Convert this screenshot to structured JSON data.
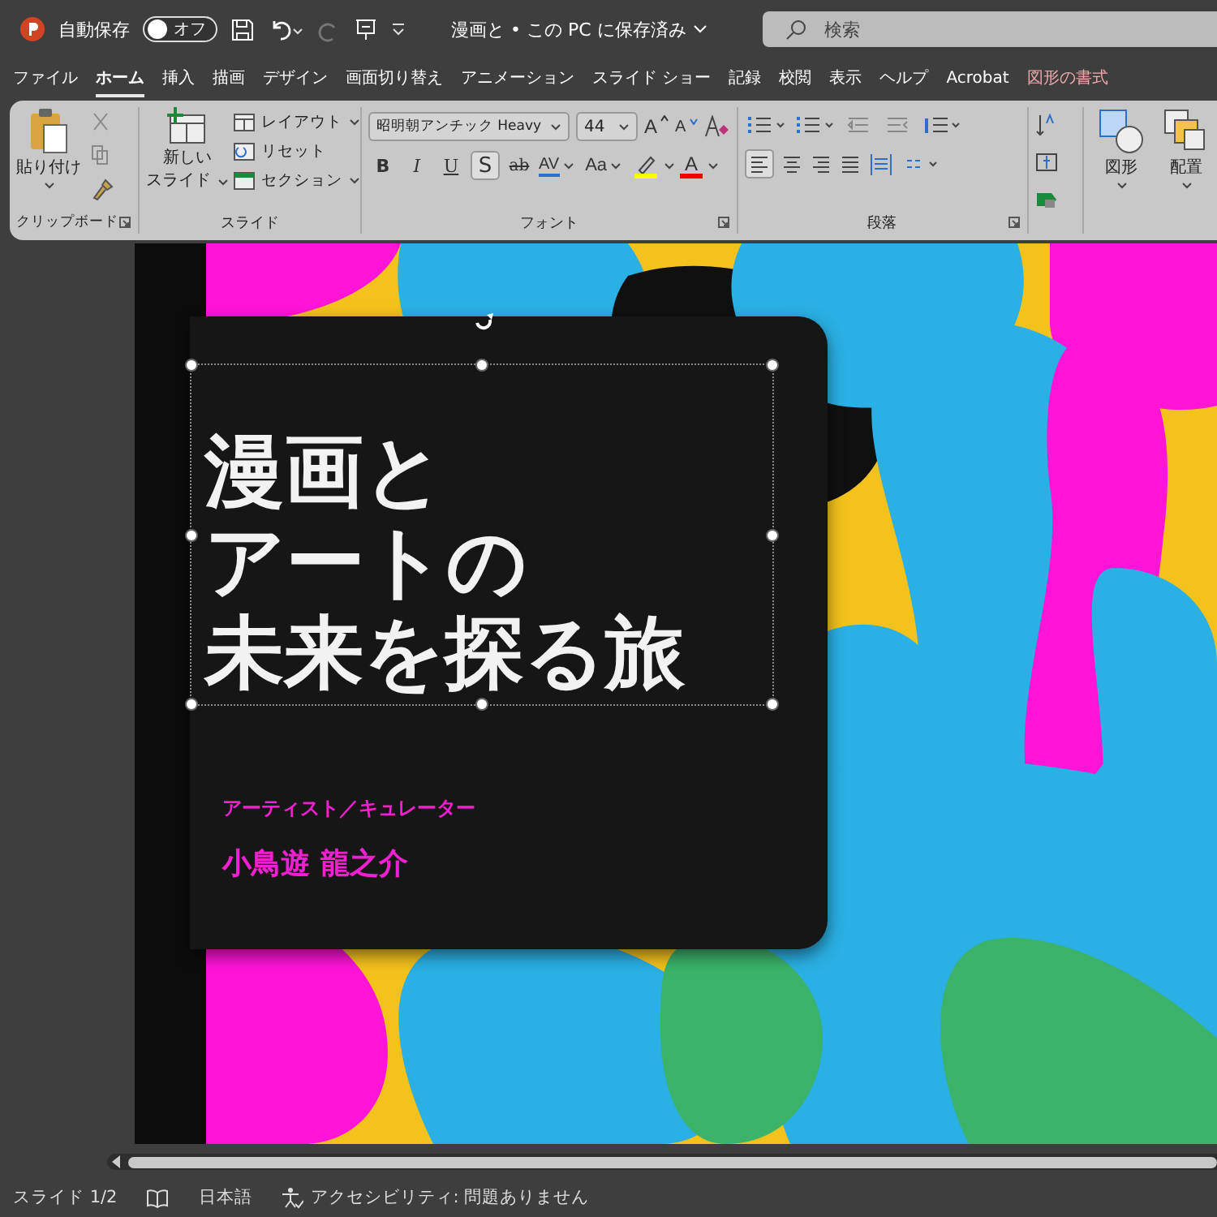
{
  "title_bar": {
    "autosave_label": "自動保存",
    "autosave_toggle": {
      "label": "オフ",
      "on": false
    },
    "document_title": "漫画と • この PC に保存済み",
    "search": {
      "placeholder": "検索"
    }
  },
  "tabs": [
    {
      "label": "ファイル",
      "selected": false,
      "kind": "normal"
    },
    {
      "label": "ホーム",
      "selected": true,
      "kind": "normal"
    },
    {
      "label": "挿入",
      "selected": false,
      "kind": "normal"
    },
    {
      "label": "描画",
      "selected": false,
      "kind": "normal"
    },
    {
      "label": "デザイン",
      "selected": false,
      "kind": "normal"
    },
    {
      "label": "画面切り替え",
      "selected": false,
      "kind": "normal"
    },
    {
      "label": "アニメーション",
      "selected": false,
      "kind": "normal"
    },
    {
      "label": "スライド ショー",
      "selected": false,
      "kind": "normal"
    },
    {
      "label": "記録",
      "selected": false,
      "kind": "normal"
    },
    {
      "label": "校閲",
      "selected": false,
      "kind": "normal"
    },
    {
      "label": "表示",
      "selected": false,
      "kind": "normal"
    },
    {
      "label": "ヘルプ",
      "selected": false,
      "kind": "normal"
    },
    {
      "label": "Acrobat",
      "selected": false,
      "kind": "normal"
    },
    {
      "label": "図形の書式",
      "selected": false,
      "kind": "contextual"
    }
  ],
  "ribbon": {
    "clipboard": {
      "paste_label": "貼り付け",
      "group_label": "クリップボード"
    },
    "slides": {
      "new_slide_lines": [
        "新しい",
        "スライド"
      ],
      "layout": "レイアウト",
      "reset": "リセット",
      "section": "セクション",
      "group_label": "スライド"
    },
    "font": {
      "font_name": "昭明朝アンチック Heavy",
      "font_size": "44",
      "format_buttons": [
        {
          "label": "B",
          "kind": "bold",
          "selected": false
        },
        {
          "label": "I",
          "kind": "italic",
          "selected": false
        },
        {
          "label": "U",
          "kind": "underline",
          "selected": false
        },
        {
          "label": "S",
          "kind": "shadow",
          "selected": true
        },
        {
          "label": "ab",
          "kind": "strike",
          "selected": false
        }
      ],
      "spacing_label": "AV",
      "case_label": "Aa",
      "grow_label": "A",
      "shrink_label": "A",
      "color_label": "A",
      "group_label": "フォント"
    },
    "paragraph": {
      "group_label": "段落"
    },
    "drawing": {
      "shape_label": "図形",
      "arrange_label": "配置"
    }
  },
  "slide": {
    "title": {
      "lines": [
        "漫画と",
        "アートの",
        "未来を探る旅"
      ],
      "selected": true
    },
    "role": "アーティスト／キュレーター",
    "name": "小鳥遊 龍之介"
  },
  "status_bar": {
    "slide_indicator": "スライド 1/2",
    "language": "日本語",
    "accessibility": "アクセシビリティ: 問題ありません"
  }
}
